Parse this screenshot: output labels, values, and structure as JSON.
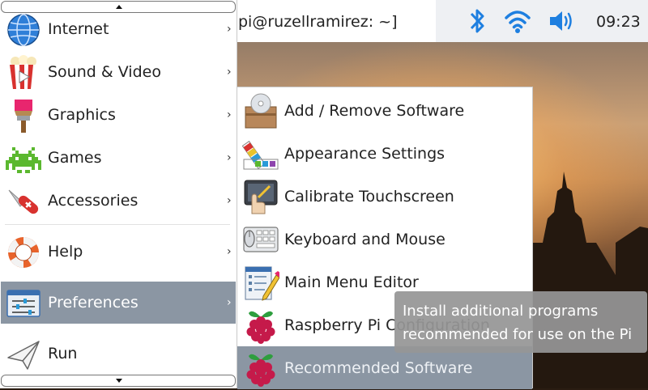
{
  "taskbar": {
    "terminal_title": "pi@ruzellramirez: ~]",
    "clock": "09:23",
    "icons": [
      "bluetooth-icon",
      "wifi-icon",
      "volume-icon"
    ],
    "accent_color": "#1e7fe0"
  },
  "menu": {
    "items": [
      {
        "label": "Internet",
        "icon": "globe-icon"
      },
      {
        "label": "Sound & Video",
        "icon": "popcorn-icon"
      },
      {
        "label": "Graphics",
        "icon": "paintbrush-icon"
      },
      {
        "label": "Games",
        "icon": "space-invader-icon"
      },
      {
        "label": "Accessories",
        "icon": "pocket-knife-icon"
      },
      {
        "label": "Help",
        "icon": "lifebuoy-icon"
      },
      {
        "label": "Preferences",
        "icon": "preferences-icon"
      },
      {
        "label": "Run",
        "icon": "paper-plane-icon"
      }
    ],
    "selected": "Preferences",
    "chevron": "›"
  },
  "submenu": {
    "items": [
      {
        "label": "Add / Remove Software",
        "icon": "package-icon"
      },
      {
        "label": "Appearance Settings",
        "icon": "palette-icon"
      },
      {
        "label": "Calibrate Touchscreen",
        "icon": "touchscreen-icon"
      },
      {
        "label": "Keyboard and Mouse",
        "icon": "keyboard-mouse-icon"
      },
      {
        "label": "Main Menu Editor",
        "icon": "menu-editor-icon"
      },
      {
        "label": "Raspberry Pi Configuration",
        "icon": "raspberry-icon"
      },
      {
        "label": "Recommended Software",
        "icon": "raspberry-icon"
      }
    ],
    "selected": "Recommended Software"
  },
  "tooltip": {
    "line1": "Install additional programs",
    "line2": "recommended for use on the Pi"
  }
}
